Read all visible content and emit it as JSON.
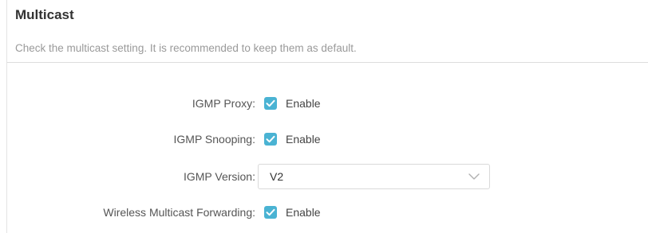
{
  "section": {
    "title": "Multicast",
    "description": "Check the multicast setting. It is recommended to keep them as default."
  },
  "settings": {
    "igmp_proxy": {
      "label": "IGMP Proxy:",
      "checkbox_label": "Enable",
      "checked": true
    },
    "igmp_snooping": {
      "label": "IGMP Snooping:",
      "checkbox_label": "Enable",
      "checked": true
    },
    "igmp_version": {
      "label": "IGMP Version:",
      "value": "V2"
    },
    "wireless_multicast_forwarding": {
      "label": "Wireless Multicast Forwarding:",
      "checkbox_label": "Enable",
      "checked": true
    }
  },
  "colors": {
    "checkbox_accent": "#4ab3d3",
    "title_text": "#333333",
    "description_text": "#9a9a9a"
  },
  "icons": {
    "checkbox": "checkmark-icon",
    "dropdown": "chevron-down-icon"
  }
}
